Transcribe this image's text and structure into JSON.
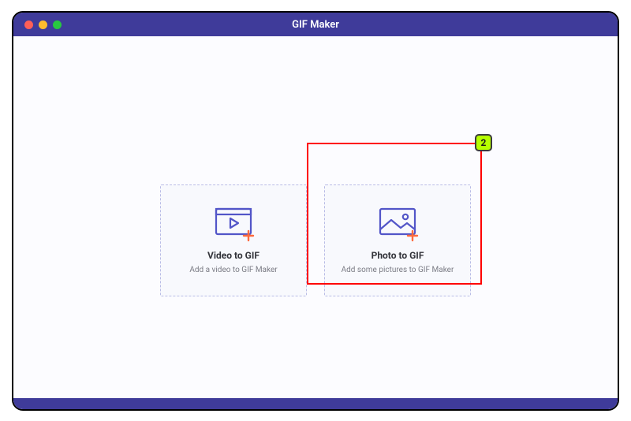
{
  "window": {
    "title": "GIF Maker"
  },
  "cards": {
    "video": {
      "title": "Video to GIF",
      "subtitle": "Add a video to GIF Maker"
    },
    "photo": {
      "title": "Photo to GIF",
      "subtitle": "Add some pictures to GIF Maker"
    }
  },
  "annotation": {
    "badge": "2"
  },
  "colors": {
    "brand": "#3f3b9a",
    "cardBorder": "#b9bce6",
    "iconStroke": "#5255c8",
    "plus": "#ff6a3d",
    "highlight": "#ff0000",
    "badgeFill": "#b6ff00"
  }
}
